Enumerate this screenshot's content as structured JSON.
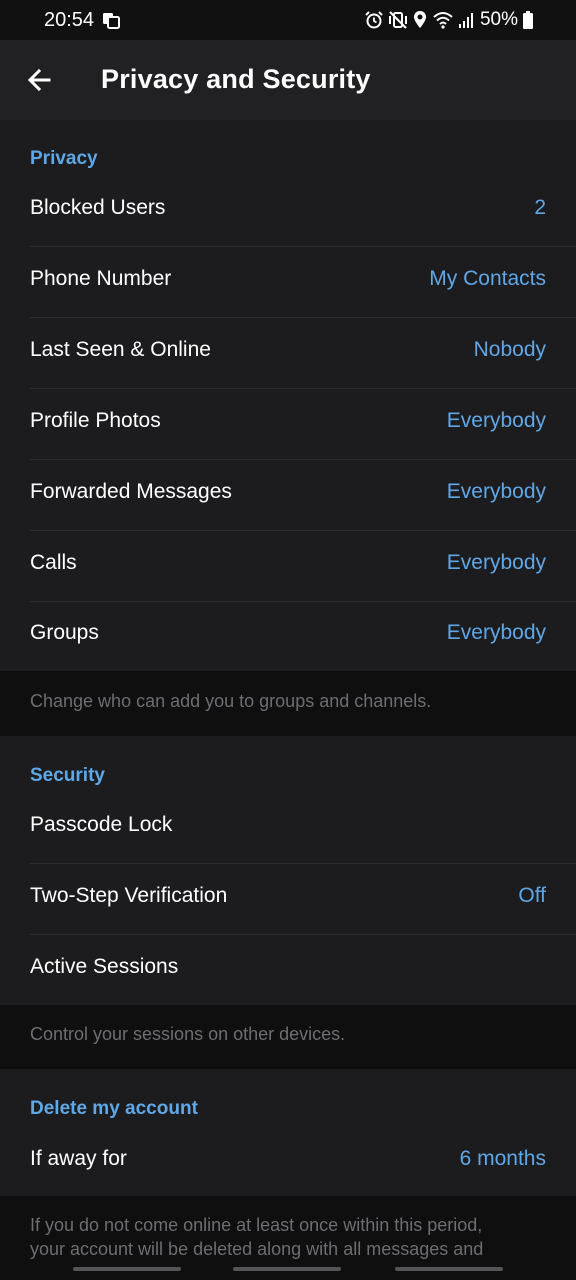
{
  "status_bar": {
    "time": "20:54",
    "battery": "50%",
    "icons": [
      "screenshot-icon",
      "alarm-icon",
      "mute-vibrate-icon",
      "location-icon",
      "wifi-icon",
      "signal-icon",
      "battery-icon"
    ]
  },
  "header": {
    "title": "Privacy and Security",
    "back_icon": "arrow-left-icon"
  },
  "privacy": {
    "title": "Privacy",
    "rows": [
      {
        "label": "Blocked Users",
        "value": "2"
      },
      {
        "label": "Phone Number",
        "value": "My Contacts"
      },
      {
        "label": "Last Seen & Online",
        "value": "Nobody"
      },
      {
        "label": "Profile Photos",
        "value": "Everybody"
      },
      {
        "label": "Forwarded Messages",
        "value": "Everybody"
      },
      {
        "label": "Calls",
        "value": "Everybody"
      },
      {
        "label": "Groups",
        "value": "Everybody"
      }
    ],
    "note": "Change who can add you to groups and channels."
  },
  "security": {
    "title": "Security",
    "rows": [
      {
        "label": "Passcode Lock",
        "value": ""
      },
      {
        "label": "Two-Step Verification",
        "value": "Off"
      },
      {
        "label": "Active Sessions",
        "value": ""
      }
    ],
    "note": "Control your sessions on other devices."
  },
  "delete_account": {
    "title": "Delete my account",
    "rows": [
      {
        "label": "If away for",
        "value": "6 months"
      }
    ],
    "note_line1": "If you do not come online at least once within this period,",
    "note_line2": "your account will be deleted along with all messages and"
  },
  "colors": {
    "accent": "#5fa7e6",
    "section_bg": "#1c1c1e",
    "page_bg": "#0f0f10",
    "appbar_bg": "#212123"
  }
}
